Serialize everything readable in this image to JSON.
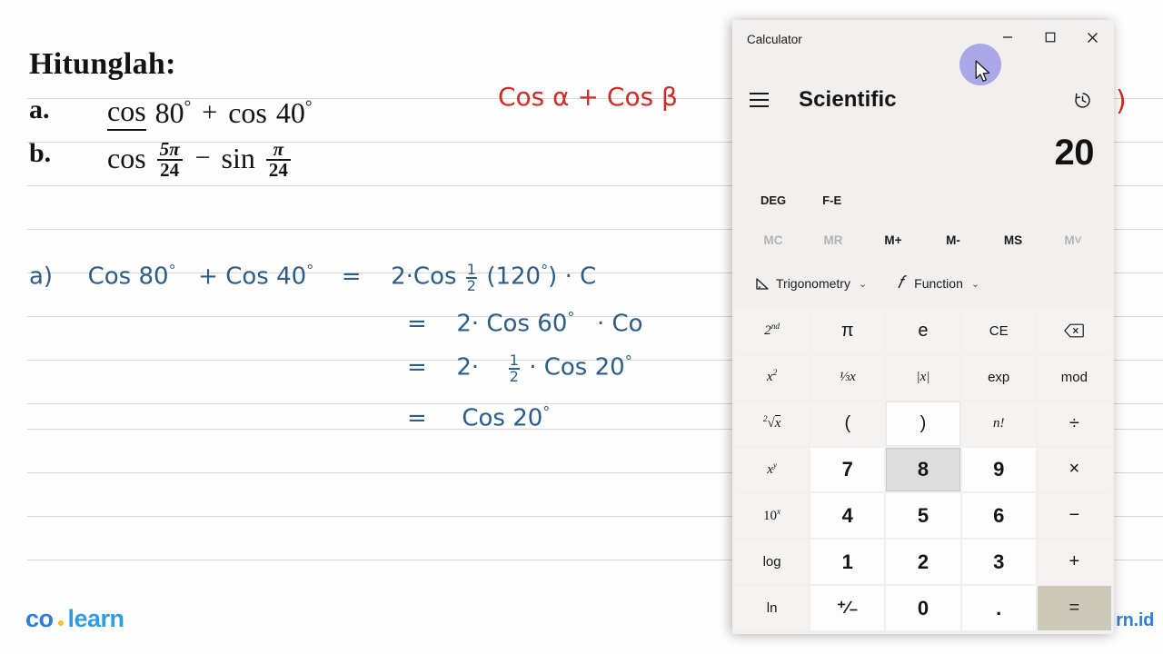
{
  "notebook": {
    "problem": {
      "title": "Hitunglah:",
      "items": [
        {
          "label": "a.",
          "expr_plain": "cos 80° + cos 40°"
        },
        {
          "label": "b.",
          "expr_plain": "cos 5π/24 − sin π/24"
        }
      ],
      "a": {
        "cos1": "cos",
        "val1": "80",
        "op": "+",
        "cos2": "cos",
        "val2": "40",
        "degree": "°"
      },
      "b": {
        "cos": "cos",
        "num1": "5π",
        "den1": "24",
        "op": "−",
        "sin": "sin",
        "num2": "π",
        "den2": "24"
      }
    },
    "red_note": {
      "text": "Cos α + Cos β",
      "clipped_paren": ")",
      "color": "#cf2b24"
    },
    "work": {
      "color": "#2c5d86",
      "line1_label": "a)",
      "line1": "Cos 80° + Cos 40°  =  2· Cos ½(120°) · C",
      "step2": "=  2· Cos 60° · Co",
      "step3": "=  2·  ½ ·  Cos 20°",
      "step4": "=  Cos 20°",
      "pieces": {
        "l1_a": "a)",
        "l1_b": "Cos 80",
        "l1_deg": "°",
        "l1_c": "+ Cos 40",
        "l1_eq": "=",
        "l1_d": "2·Cos",
        "l1_frac_n": "1",
        "l1_frac_d": "2",
        "l1_e": "(120",
        "l1_f": ") · C",
        "l2_eq": "=",
        "l2_a": "2· Cos 60",
        "l2_b": "· Co",
        "l3_eq": "=",
        "l3_a": "2·",
        "l3_fn": "1",
        "l3_fd": "2",
        "l3_b": "· Cos 20",
        "l4_eq": "=",
        "l4_a": "Cos 20"
      }
    },
    "logo": {
      "part1": "co",
      "dot": "·",
      "part2": "learn"
    },
    "watermark": "rn.id"
  },
  "calculator": {
    "window": {
      "app_title": "Calculator",
      "minimize_label": "Minimize",
      "maximize_label": "Maximize",
      "close_label": "Close"
    },
    "nav": {
      "menu_label": "Open Navigation",
      "mode_title": "Scientific",
      "history_label": "History"
    },
    "display": {
      "result": "20"
    },
    "toggles": [
      {
        "id": "deg",
        "label": "DEG"
      },
      {
        "id": "fe",
        "label": "F-E"
      }
    ],
    "memory": [
      {
        "label": "MC",
        "disabled": true
      },
      {
        "label": "MR",
        "disabled": true
      },
      {
        "label": "M+",
        "disabled": false
      },
      {
        "label": "M-",
        "disabled": false
      },
      {
        "label": "MS",
        "disabled": false
      },
      {
        "label": "M˅",
        "disabled": true
      }
    ],
    "dropdowns": [
      {
        "icon": "trigonometry-icon",
        "label": "Trigonometry",
        "chevron": "⌄"
      },
      {
        "icon": "function-icon",
        "label": "Function",
        "chevron": "⌄"
      }
    ],
    "keys": [
      {
        "label": "2nd",
        "sup": "nd",
        "base": "2",
        "name": "second-key",
        "style": "fn"
      },
      {
        "label": "π",
        "name": "pi-key",
        "style": "op"
      },
      {
        "label": "e",
        "name": "e-key",
        "style": "op"
      },
      {
        "label": "CE",
        "name": "clear-entry-key",
        "style": "fnplain"
      },
      {
        "label": "⌫",
        "name": "backspace-key",
        "style": "op"
      },
      {
        "label": "x2",
        "sup": "2",
        "base": "x",
        "name": "square-key",
        "style": "fn"
      },
      {
        "label": "1/x",
        "name": "reciprocal-key",
        "style": "fn"
      },
      {
        "label": "|x|",
        "name": "absolute-value-key",
        "style": "fn"
      },
      {
        "label": "exp",
        "name": "exponent-key",
        "style": "fnplain"
      },
      {
        "label": "mod",
        "name": "modulo-key",
        "style": "fnplain"
      },
      {
        "label": "2√x",
        "name": "square-root-key",
        "style": "fn"
      },
      {
        "label": "(",
        "name": "open-paren-key",
        "style": "op"
      },
      {
        "label": ")",
        "name": "close-paren-key",
        "style": "op",
        "state": "softhover"
      },
      {
        "label": "n!",
        "name": "factorial-key",
        "style": "fn"
      },
      {
        "label": "÷",
        "name": "divide-key",
        "style": "op"
      },
      {
        "label": "xy",
        "sup": "y",
        "base": "x",
        "name": "power-key",
        "style": "fn"
      },
      {
        "label": "7",
        "name": "seven-key",
        "style": "num"
      },
      {
        "label": "8",
        "name": "eight-key",
        "style": "num",
        "state": "hover"
      },
      {
        "label": "9",
        "name": "nine-key",
        "style": "num"
      },
      {
        "label": "×",
        "name": "multiply-key",
        "style": "op"
      },
      {
        "label": "10x",
        "sup": "x",
        "base": "10",
        "name": "ten-power-key",
        "style": "fn"
      },
      {
        "label": "4",
        "name": "four-key",
        "style": "num"
      },
      {
        "label": "5",
        "name": "five-key",
        "style": "num"
      },
      {
        "label": "6",
        "name": "six-key",
        "style": "num"
      },
      {
        "label": "−",
        "name": "subtract-key",
        "style": "op"
      },
      {
        "label": "log",
        "name": "log-key",
        "style": "fnplain"
      },
      {
        "label": "1",
        "name": "one-key",
        "style": "num"
      },
      {
        "label": "2",
        "name": "two-key",
        "style": "num"
      },
      {
        "label": "3",
        "name": "three-key",
        "style": "num"
      },
      {
        "label": "+",
        "name": "add-key",
        "style": "op"
      },
      {
        "label": "ln",
        "name": "ln-key",
        "style": "fnplain"
      },
      {
        "label": "+/-",
        "name": "negate-key",
        "style": "num"
      },
      {
        "label": "0",
        "name": "zero-key",
        "style": "num"
      },
      {
        "label": ".",
        "name": "decimal-key",
        "style": "num"
      },
      {
        "label": "=",
        "name": "equals-key",
        "style": "equals"
      }
    ],
    "colors": {
      "window_bg": "#f1f0ef",
      "key_bg": "#fbfbfb",
      "equals_accent": "#cdc9b8",
      "hover": "#dcdcdc",
      "cursor_halo": "#9b97e8"
    }
  }
}
